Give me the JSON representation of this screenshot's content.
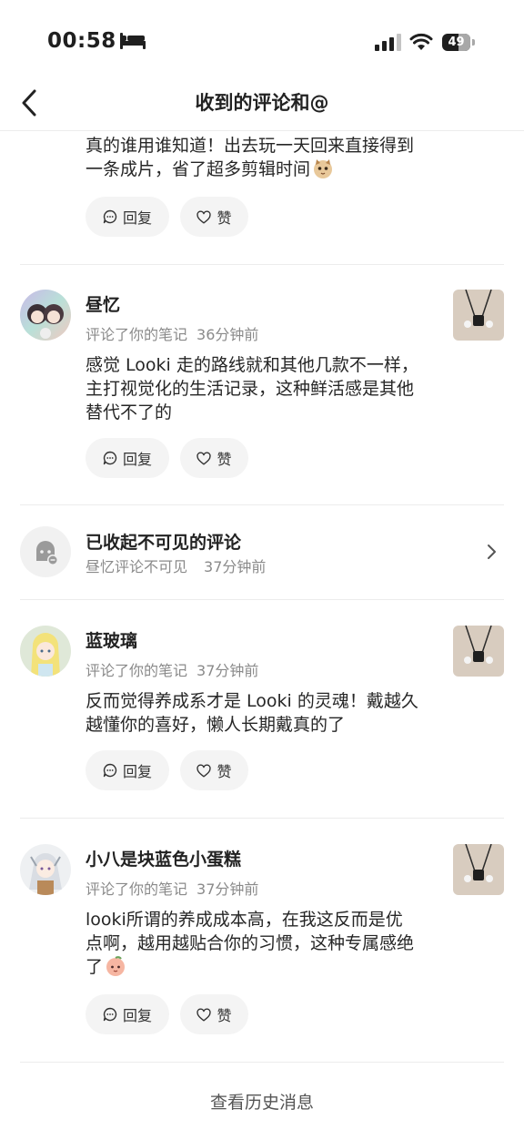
{
  "status_bar": {
    "time": "00:58",
    "battery": "49"
  },
  "nav": {
    "title": "收到的评论和@"
  },
  "top_comment": {
    "text_line1": "真的谁用谁知道！出去玩一天回来直接得到",
    "text_line2": "一条成片，省了超多剪辑时间",
    "reply_label": "回复",
    "like_label": "赞"
  },
  "comments": [
    {
      "username": "昼忆",
      "action": "评论了你的笔记",
      "time": "36分钟前",
      "lines": [
        "感觉 Looki 走的路线就和其他几款不一样，",
        "主打视觉化的生活记录，这种鲜活感是其他",
        "替代不了的"
      ],
      "reply_label": "回复",
      "like_label": "赞"
    },
    {
      "username": "蓝玻璃",
      "action": "评论了你的笔记",
      "time": "37分钟前",
      "lines": [
        "反而觉得养成系才是 Looki 的灵魂！戴越久",
        "越懂你的喜好，懒人长期戴真的了"
      ],
      "reply_label": "回复",
      "like_label": "赞"
    },
    {
      "username": "小八是块蓝色小蛋糕",
      "action": "评论了你的笔记",
      "time": "37分钟前",
      "lines": [
        "looki所谓的养成成本高，在我这反而是优",
        "点啊，越用越贴合你的习惯，这种专属感绝",
        "了"
      ],
      "reply_label": "回复",
      "like_label": "赞"
    }
  ],
  "hidden_comment": {
    "title": "已收起不可见的评论",
    "subtitle": "昼忆评论不可见",
    "time": "37分钟前"
  },
  "footer": {
    "history_link": "查看历史消息"
  },
  "icons": {
    "back": "chevron-left-icon",
    "reply": "comment-bubble-icon",
    "like": "heart-icon",
    "hidden": "ghost-hidden-icon",
    "more": "chevron-right-icon"
  },
  "colors": {
    "pill_bg": "#f4f4f4",
    "meta_text": "#8a8a8a",
    "divider": "#ececec"
  }
}
